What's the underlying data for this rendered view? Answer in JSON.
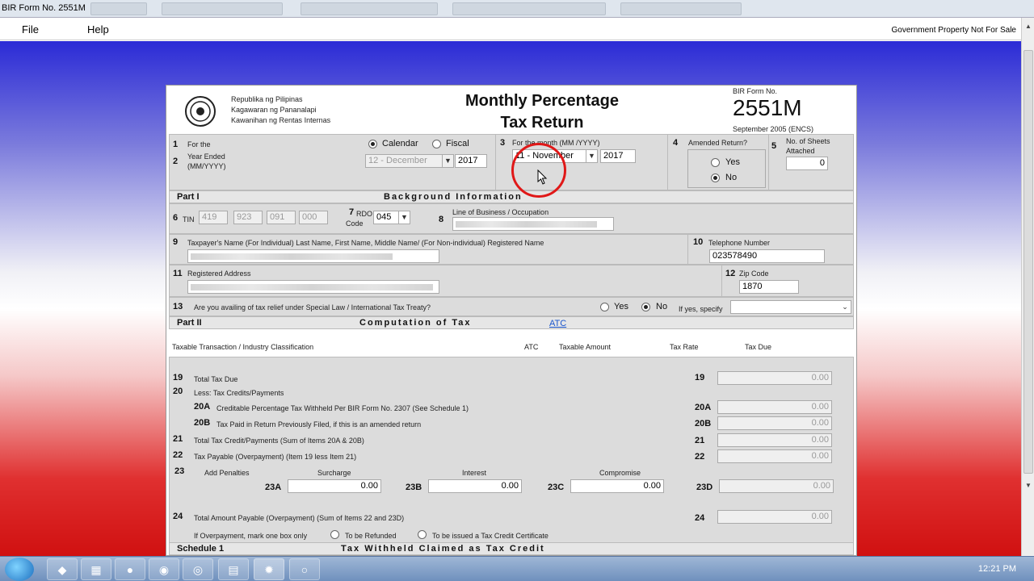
{
  "window": {
    "title": "BIR Form No. 2551M"
  },
  "menu": {
    "file": "File",
    "help": "Help",
    "gov_note": "Government Property Not For Sale"
  },
  "header": {
    "agency_line1": "Republika ng Pilipinas",
    "agency_line2": "Kagawaran ng Pananalapi",
    "agency_line3": "Kawanihan ng Rentas Internas",
    "title_line1": "Monthly Percentage",
    "title_line2": "Tax Return",
    "form_no_label": "BIR Form No.",
    "form_no": "2551M",
    "form_date": "September 2005 (ENCS)"
  },
  "item1": {
    "n1": "1",
    "n2": "2",
    "for_the": "For the",
    "year_ended": "Year Ended",
    "mmyyyy": "(MM/YYYY)",
    "calendar": "Calendar",
    "fiscal": "Fiscal",
    "month_value": "12 - December",
    "year_value": "2017"
  },
  "item3": {
    "n": "3",
    "label": "For the month (MM /YYYY)",
    "month_value": "11 - November",
    "year_value": "2017"
  },
  "item4": {
    "n": "4",
    "label": "Amended Return?",
    "yes": "Yes",
    "no": "No"
  },
  "item5": {
    "n": "5",
    "label1": "No. of Sheets",
    "label2": "Attached",
    "value": "0"
  },
  "part1": {
    "label": "Part I",
    "title": "Background Information",
    "n6": "6",
    "tin": "TIN",
    "tin1": "419",
    "tin2": "923",
    "tin3": "091",
    "tin4": "000",
    "n7": "7",
    "rdo": "RDO",
    "code": "Code",
    "rdo_value": "045",
    "n8": "8",
    "line_of_business": "Line of Business / Occupation",
    "n9": "9",
    "taxpayer_name": "Taxpayer's Name (For Individual) Last Name, First Name, Middle Name/ (For Non-individual) Registered Name",
    "n10": "10",
    "telephone": "Telephone Number",
    "telephone_value": "023578490",
    "n11": "11",
    "address": "Registered Address",
    "n12": "12",
    "zip": "Zip Code",
    "zip_value": "1870",
    "n13": "13",
    "relief": "Are you availing of tax relief under Special Law / International Tax Treaty?",
    "yes": "Yes",
    "no": "No",
    "if_yes": "If yes, specify"
  },
  "part2": {
    "label": "Part II",
    "title": "Computation of Tax",
    "atc_link": "ATC",
    "col_txn": "Taxable Transaction / Industry Classification",
    "col_atc": "ATC",
    "col_amount": "Taxable Amount",
    "col_rate": "Tax Rate",
    "col_due": "Tax Due",
    "rows": {
      "r19": {
        "n": "19",
        "label": "Total Tax Due",
        "code": "19",
        "value": "0.00"
      },
      "r20": {
        "n": "20",
        "label": "Less: Tax Credits/Payments"
      },
      "r20a": {
        "n": "20A",
        "label": "Creditable Percentage Tax Withheld Per BIR Form No. 2307 (See Schedule 1)",
        "code": "20A",
        "value": "0.00"
      },
      "r20b": {
        "n": "20B",
        "label": "Tax Paid in Return Previously Filed, if this is an amended return",
        "code": "20B",
        "value": "0.00"
      },
      "r21": {
        "n": "21",
        "label": "Total Tax Credit/Payments (Sum of Items 20A & 20B)",
        "code": "21",
        "value": "0.00"
      },
      "r22": {
        "n": "22",
        "label": "Tax Payable (Overpayment) (Item 19 less Item 21)",
        "code": "22",
        "value": "0.00"
      },
      "r23": {
        "n": "23",
        "label": "Add Penalties",
        "surcharge": "Surcharge",
        "interest": "Interest",
        "compromise": "Compromise",
        "c23a": "23A",
        "v23a": "0.00",
        "c23b": "23B",
        "v23b": "0.00",
        "c23c": "23C",
        "v23c": "0.00",
        "c23d": "23D",
        "v23d": "0.00"
      },
      "r24": {
        "n": "24",
        "label": "Total Amount Payable (Overpayment) (Sum of Items 22 and 23D)",
        "code": "24",
        "value": "0.00"
      }
    },
    "overpayment": "If Overpayment, mark one box only",
    "refunded": "To be Refunded",
    "tcc": "To be issued a Tax Credit Certificate"
  },
  "schedule1": {
    "label": "Schedule 1",
    "title": "Tax Withheld Claimed as Tax Credit"
  },
  "taskbar": {
    "time": "12:21 PM"
  }
}
